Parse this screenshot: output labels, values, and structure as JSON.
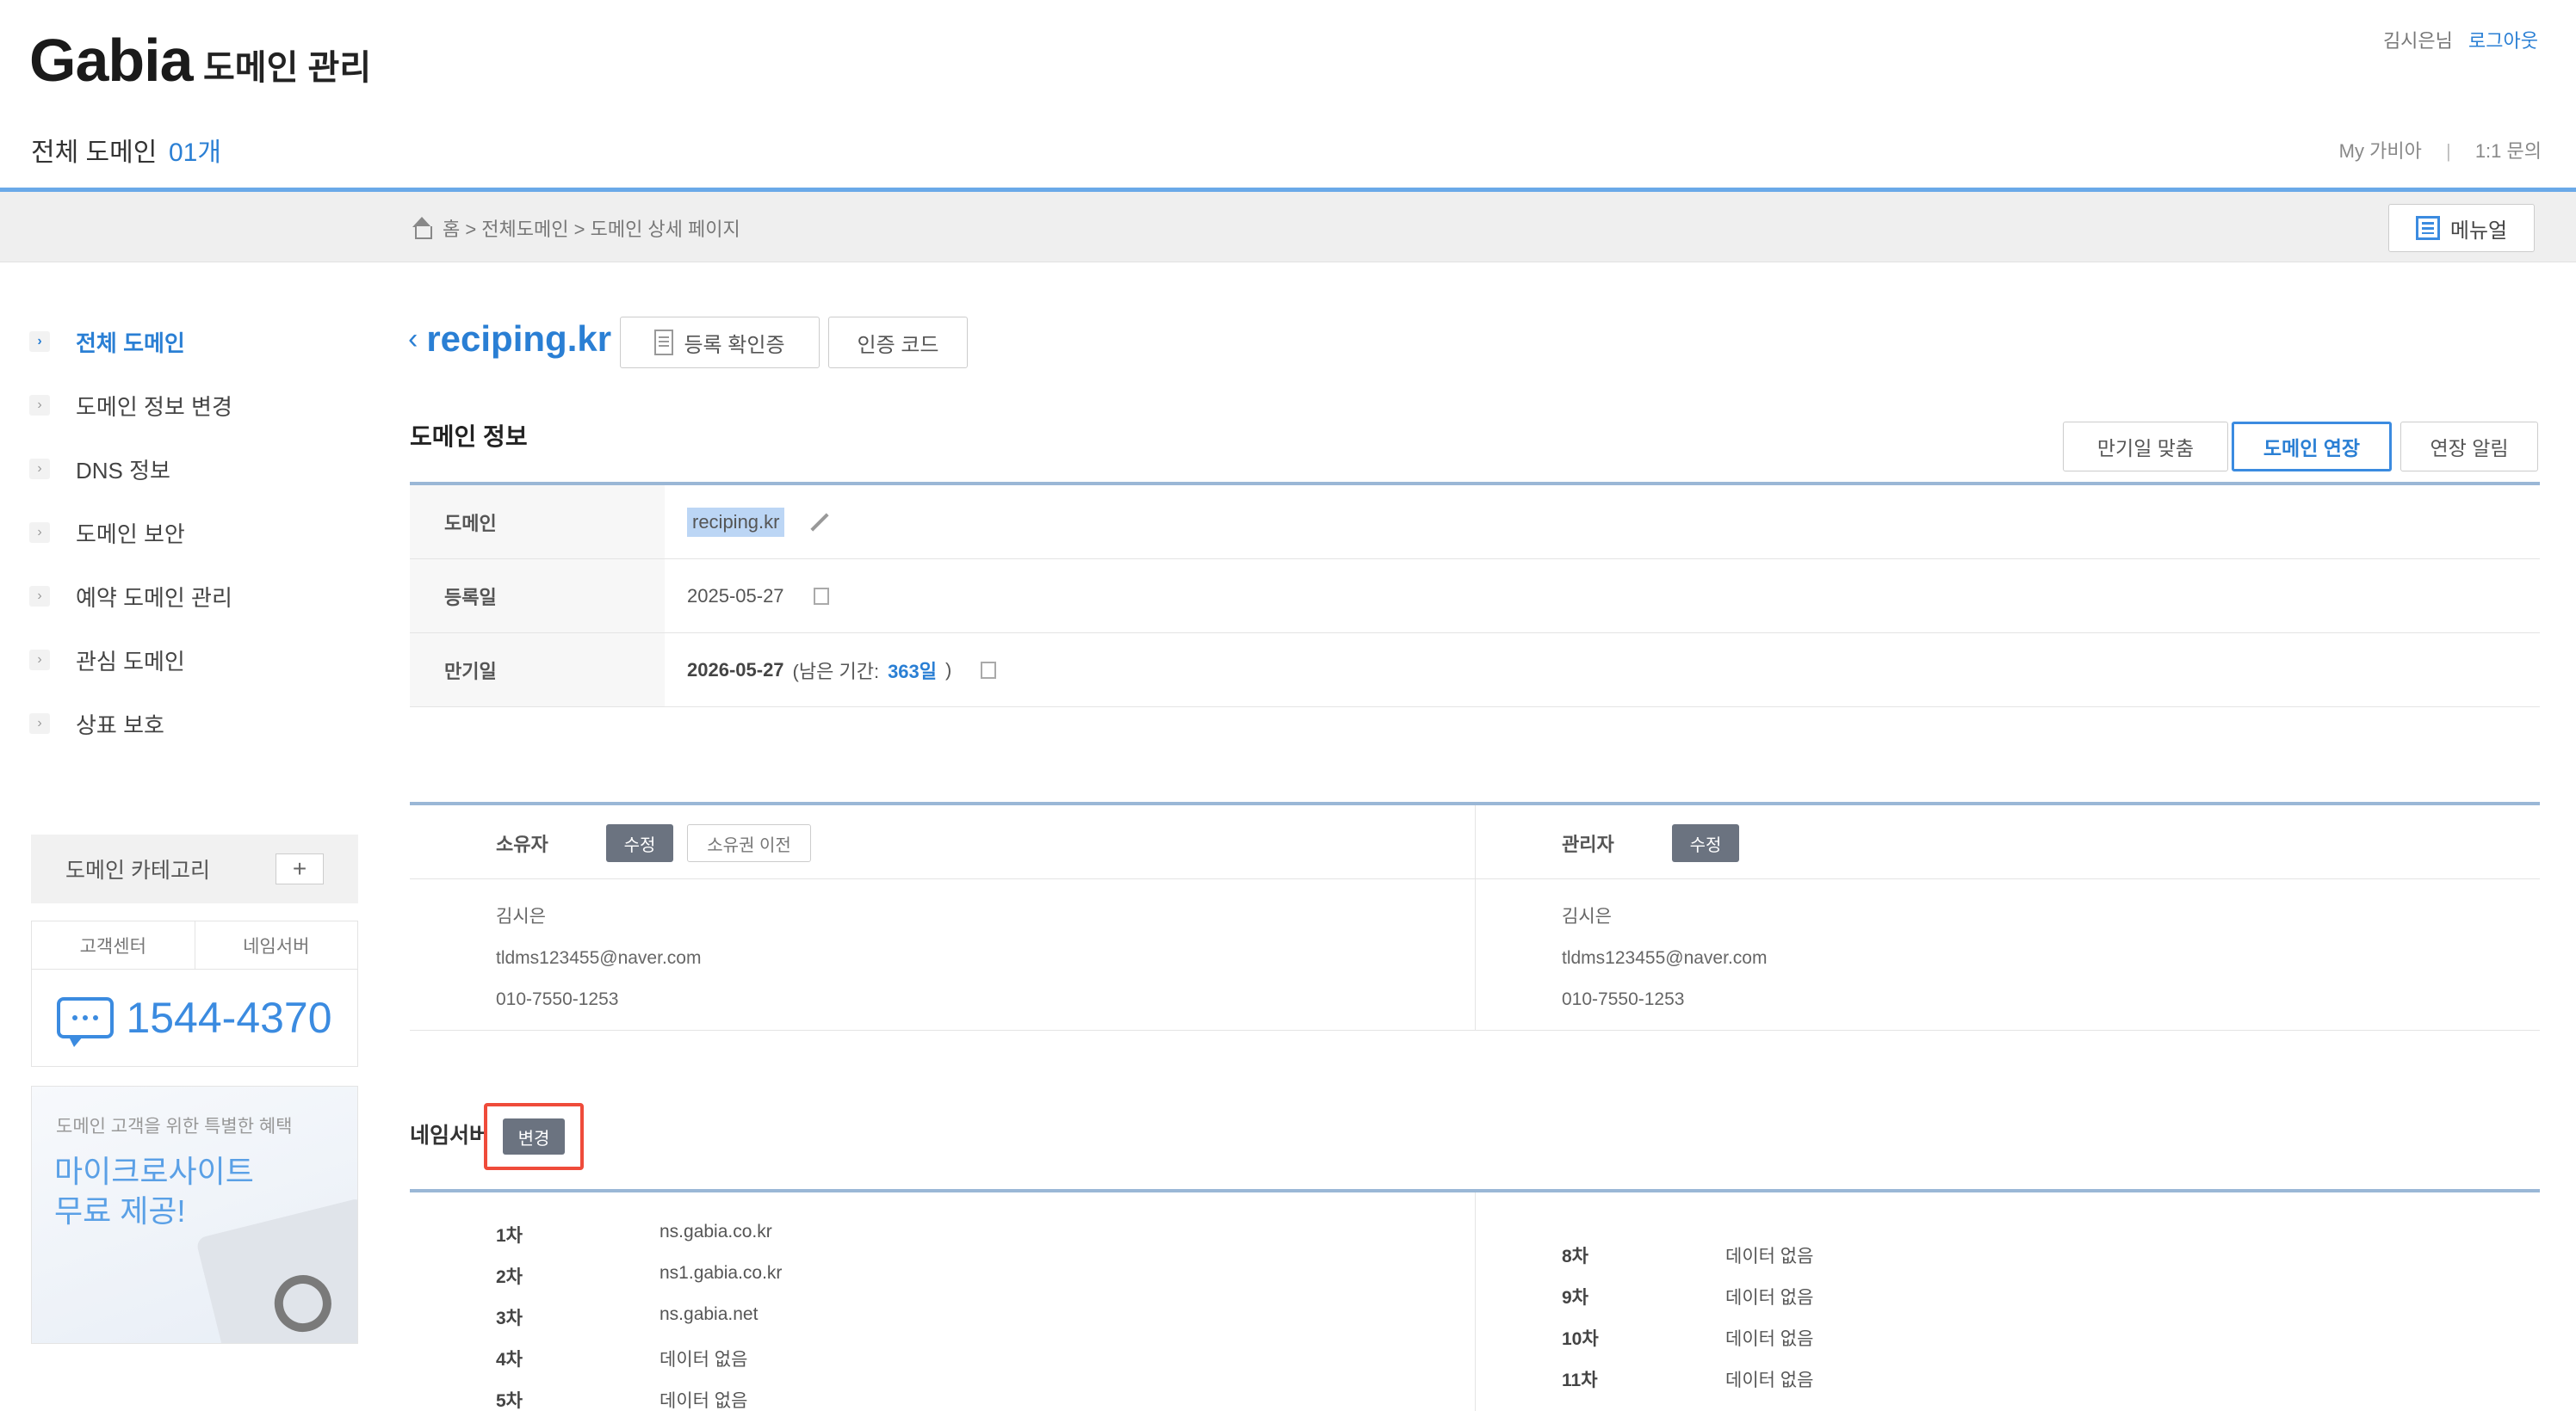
{
  "header": {
    "logo": "Gabia",
    "logo_sub": "도메인 관리",
    "total_label": "전체 도메인",
    "total_count": "01개",
    "user_name": "김시은님",
    "logout": "로그아웃",
    "link_my": "My 가비아",
    "link_sep": "|",
    "link_qna": "1:1 문의"
  },
  "breadcrumb": {
    "path": "홈 > 전체도메인 > 도메인 상세 페이지",
    "menu_label": "메뉴얼"
  },
  "sidebar": {
    "items": [
      {
        "label": "전체 도메인"
      },
      {
        "label": "도메인 정보 변경"
      },
      {
        "label": "DNS 정보"
      },
      {
        "label": "도메인 보안"
      },
      {
        "label": "예약 도메인 관리"
      },
      {
        "label": "관심 도메인"
      },
      {
        "label": "상표 보호"
      }
    ],
    "category_label": "도메인 카테고리",
    "category_add": "+",
    "cs_tab1": "고객센터",
    "cs_tab2": "네임서버",
    "phone": "1544-4370",
    "promo_small": "도메인 고객을 위한 특별한 혜택",
    "promo_big_1": "마이크로사이트",
    "promo_big_2": "무료 제공!"
  },
  "main": {
    "back": "‹",
    "domain": "reciping.kr",
    "btn_cert": "등록 확인증",
    "btn_auth": "인증 코드",
    "section_title": "도메인 정보",
    "btn_auto": "만기일 맞춤",
    "btn_extend": "도메인 연장",
    "btn_notify": "연장 알림",
    "info": {
      "domain_label": "도메인",
      "domain_value": "reciping.kr",
      "reg_label": "등록일",
      "reg_value": "2025-05-27",
      "exp_label": "만기일",
      "exp_value": "2026-05-27",
      "remain_prefix": "(남은 기간:",
      "remain_days": "363일",
      "remain_suffix": ")"
    },
    "owner": {
      "label": "소유자",
      "edit": "수정",
      "transfer": "소유권 이전",
      "name": "김시은",
      "email": "tldms123455@naver.com",
      "phone": "010-7550-1253"
    },
    "admin": {
      "label": "관리자",
      "edit": "수정",
      "name": "김시은",
      "email": "tldms123455@naver.com",
      "phone": "010-7550-1253"
    },
    "ns": {
      "title": "네임서버",
      "edit": "변경",
      "left": [
        {
          "num": "1차",
          "value": "ns.gabia.co.kr"
        },
        {
          "num": "2차",
          "value": "ns1.gabia.co.kr"
        },
        {
          "num": "3차",
          "value": "ns.gabia.net"
        },
        {
          "num": "4차",
          "value": "데이터 없음"
        },
        {
          "num": "5차",
          "value": "데이터 없음"
        }
      ],
      "right": [
        {
          "num": "8차",
          "value": "데이터 없음"
        },
        {
          "num": "9차",
          "value": "데이터 없음"
        },
        {
          "num": "10차",
          "value": "데이터 없음"
        },
        {
          "num": "11차",
          "value": "데이터 없음"
        }
      ]
    }
  }
}
